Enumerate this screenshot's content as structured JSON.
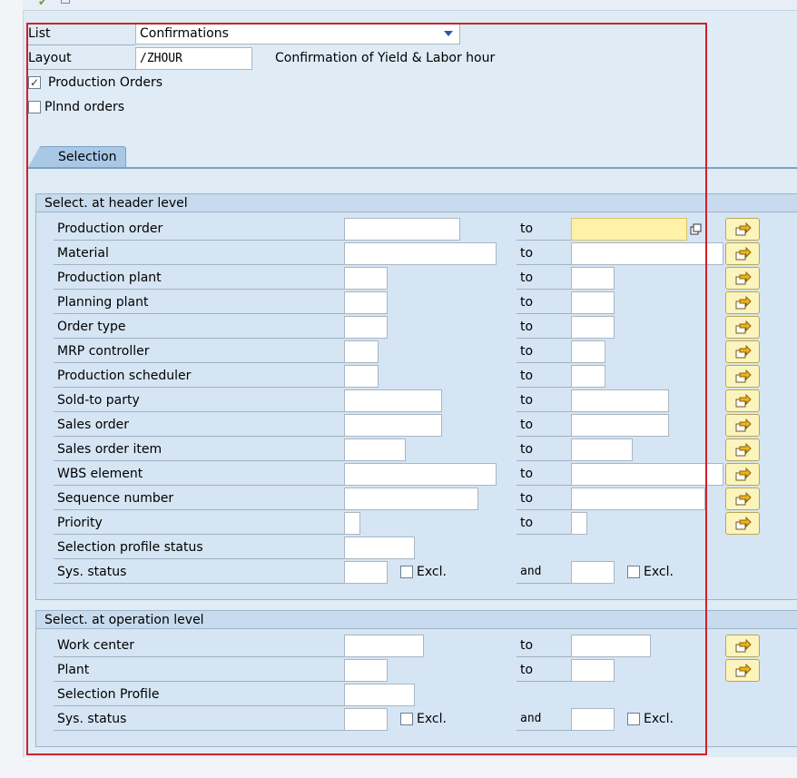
{
  "list": {
    "label": "List",
    "value": "Confirmations"
  },
  "layout": {
    "label": "Layout",
    "value": "/ZHOUR",
    "description": "Confirmation of Yield & Labor hour"
  },
  "checkboxes": [
    {
      "label": "Production Orders",
      "checked": true
    },
    {
      "label": "Plnnd orders",
      "checked": false
    }
  ],
  "tab": {
    "label": "Selection"
  },
  "header_section": {
    "title": "Select. at header level",
    "rows": [
      {
        "label": "Production order",
        "to": "to"
      },
      {
        "label": "Material",
        "to": "to"
      },
      {
        "label": "Production plant",
        "to": "to"
      },
      {
        "label": "Planning plant",
        "to": "to"
      },
      {
        "label": "Order type",
        "to": "to"
      },
      {
        "label": "MRP controller",
        "to": "to"
      },
      {
        "label": "Production scheduler",
        "to": "to"
      },
      {
        "label": "Sold-to party",
        "to": "to"
      },
      {
        "label": "Sales order",
        "to": "to"
      },
      {
        "label": "Sales order item",
        "to": "to"
      },
      {
        "label": "WBS element",
        "to": "to"
      },
      {
        "label": "Sequence number",
        "to": "to"
      },
      {
        "label": "Priority",
        "to": "to"
      },
      {
        "label": "Selection profile status"
      },
      {
        "label": "Sys. status",
        "excl": "Excl.",
        "and": "and"
      }
    ]
  },
  "operation_section": {
    "title": "Select. at operation level",
    "rows": [
      {
        "label": "Work center",
        "to": "to"
      },
      {
        "label": "Plant",
        "to": "to"
      },
      {
        "label": "Selection Profile"
      },
      {
        "label": "Sys. status",
        "excl": "Excl.",
        "and": "and"
      }
    ]
  },
  "icons": {
    "multiple_selection": "arrow-right-icon",
    "toolbar": [
      "check-icon",
      "document-icon"
    ]
  },
  "colors": {
    "focus_field": "#fff2a8",
    "highlight_frame": "#d0202a",
    "selection_button": "#fcf4bd"
  }
}
